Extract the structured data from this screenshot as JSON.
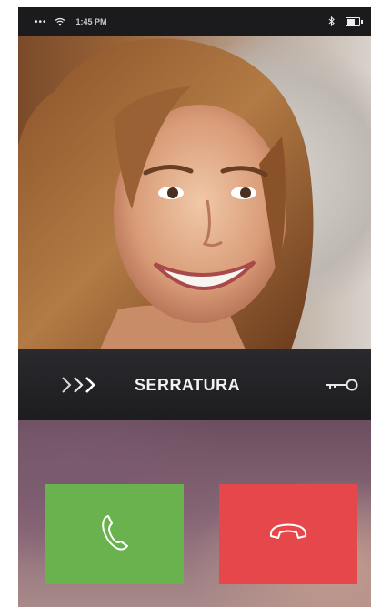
{
  "status_bar": {
    "signal": "•••",
    "time": "1:45 PM",
    "icons": [
      "wifi-icon",
      "bluetooth-icon",
      "battery-icon"
    ]
  },
  "video": {
    "description_icon": "camera-feed"
  },
  "lock_bar": {
    "label": "SERRATURA",
    "left_icon": "swipe-chevrons-icon",
    "right_icon": "key-icon"
  },
  "call_controls": {
    "answer_icon": "phone-handset-icon",
    "hangup_icon": "phone-hangup-icon",
    "colors": {
      "answer": "#6ab24e",
      "hangup": "#e5474a"
    }
  }
}
